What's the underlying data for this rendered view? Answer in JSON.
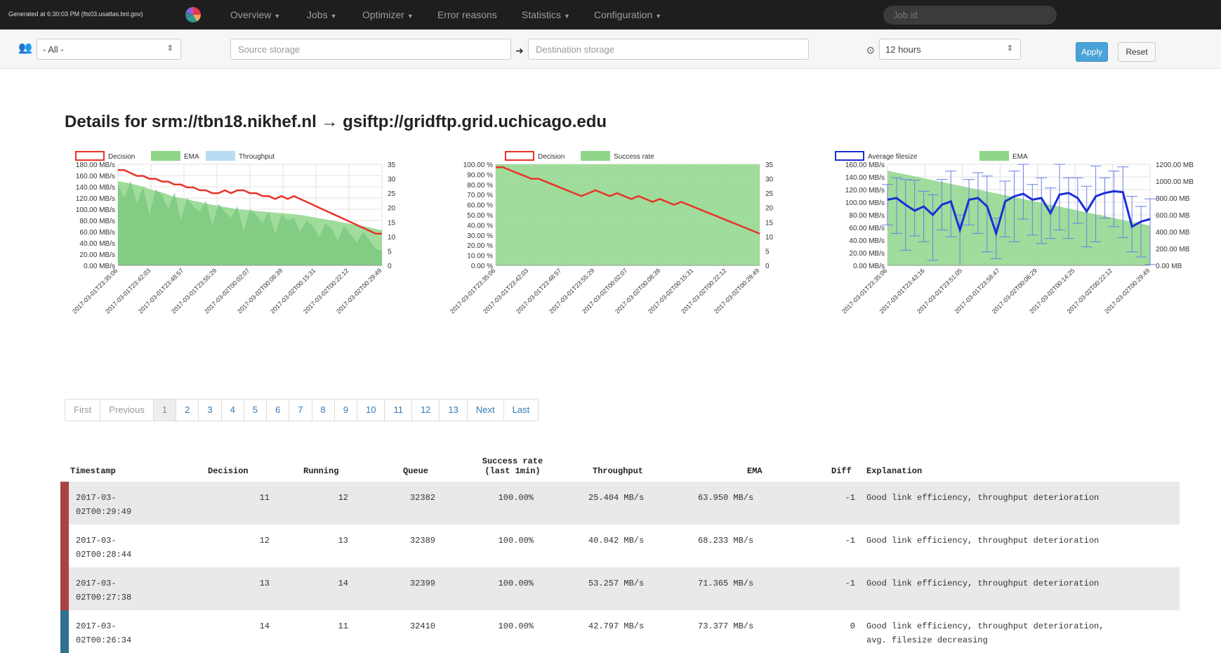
{
  "navbar": {
    "generated": "Generated at 6:30:03 PM (fts03.usatlas.bnl.gov)",
    "items": [
      {
        "label": "Overview",
        "caret": true
      },
      {
        "label": "Jobs",
        "caret": true
      },
      {
        "label": "Optimizer",
        "caret": true
      },
      {
        "label": "Error reasons",
        "caret": false
      },
      {
        "label": "Statistics",
        "caret": true
      },
      {
        "label": "Configuration",
        "caret": true
      }
    ],
    "jobid_placeholder": "Job id"
  },
  "filters": {
    "vo_value": "- All -",
    "source_placeholder": "Source storage",
    "destination_placeholder": "Destination storage",
    "time_window": "12 hours",
    "apply_label": "Apply",
    "reset_label": "Reset"
  },
  "page_title": "Details for srm://tbn18.nikhef.nl → gsiftp://gridftp.grid.uchicago.edu",
  "chart_data": [
    {
      "type": "area",
      "legend": [
        "Decision",
        "EMA",
        "Throughput"
      ],
      "y_left_ticks": [
        "180.00 MB/s",
        "160.00 MB/s",
        "140.00 MB/s",
        "120.00 MB/s",
        "100.00 MB/s",
        "80.00 MB/s",
        "60.00 MB/s",
        "40.00 MB/s",
        "20.00 MB/s",
        "0.00 MB/s"
      ],
      "y_right_ticks": [
        "35",
        "30",
        "25",
        "20",
        "15",
        "10",
        "5",
        "0"
      ],
      "x_ticks": [
        "2017-03-01T23:35:06",
        "2017-03-01T23:42:03",
        "2017-03-01T23:48:57",
        "2017-03-01T23:55:29",
        "2017-03-02T00:02:07",
        "2017-03-02T00:08:39",
        "2017-03-02T00:15:31",
        "2017-03-02T00:22:12",
        "2017-03-02T00:29:49"
      ],
      "decision": [
        33,
        33,
        32,
        31,
        31,
        30,
        30,
        29,
        29,
        28,
        28,
        27,
        27,
        26,
        26,
        25,
        25,
        26,
        25,
        26,
        26,
        25,
        25,
        24,
        24,
        23,
        24,
        23,
        24,
        23,
        22,
        21,
        20,
        19,
        18,
        17,
        16,
        15,
        14,
        13,
        12,
        11,
        11
      ],
      "ema": [
        150,
        148,
        146,
        143,
        140,
        136,
        133,
        130,
        126,
        122,
        120,
        118,
        115,
        113,
        110,
        108,
        106,
        104,
        102,
        100,
        99,
        98,
        97,
        96,
        95,
        94,
        93,
        92,
        91,
        90,
        88,
        86,
        84,
        82,
        80,
        78,
        76,
        74,
        72,
        70,
        68,
        65,
        63
      ],
      "throughput": [
        145,
        120,
        150,
        110,
        140,
        90,
        135,
        125,
        100,
        130,
        80,
        120,
        105,
        95,
        115,
        70,
        110,
        95,
        85,
        105,
        60,
        100,
        90,
        75,
        95,
        55,
        90,
        80,
        85,
        60,
        80,
        70,
        50,
        75,
        65,
        45,
        70,
        55,
        40,
        60,
        45,
        30,
        25
      ]
    },
    {
      "type": "area",
      "legend": [
        "Decision",
        "Success rate"
      ],
      "y_left_ticks": [
        "100.00 %",
        "90.00 %",
        "80.00 %",
        "70.00 %",
        "60.00 %",
        "50.00 %",
        "40.00 %",
        "30.00 %",
        "20.00 %",
        "10.00 %",
        "0.00 %"
      ],
      "y_right_ticks": [
        "35",
        "30",
        "25",
        "20",
        "15",
        "10",
        "5",
        "0"
      ],
      "x_ticks": [
        "2017-03-01T23:35:06",
        "2017-03-01T23:42:03",
        "2017-03-01T23:48:57",
        "2017-03-01T23:55:29",
        "2017-03-02T00:02:07",
        "2017-03-02T00:08:39",
        "2017-03-02T00:15:31",
        "2017-03-02T00:22:12",
        "2017-03-02T00:29:49"
      ],
      "success_rate": 100,
      "decision": [
        34,
        34,
        33,
        32,
        31,
        30,
        30,
        29,
        28,
        27,
        26,
        25,
        24,
        25,
        26,
        25,
        24,
        25,
        24,
        23,
        24,
        23,
        22,
        23,
        22,
        21,
        22,
        21,
        20,
        19,
        18,
        17,
        16,
        15,
        14,
        13,
        12,
        11
      ]
    },
    {
      "type": "area",
      "legend": [
        "Average filesize",
        "EMA"
      ],
      "y_left_ticks": [
        "160.00 MB/s",
        "140.00 MB/s",
        "120.00 MB/s",
        "100.00 MB/s",
        "80.00 MB/s",
        "60.00 MB/s",
        "40.00 MB/s",
        "20.00 MB/s",
        "0.00 MB/s"
      ],
      "y_right_ticks": [
        "1200.00 MB",
        "1000.00 MB",
        "800.00 MB",
        "600.00 MB",
        "400.00 MB",
        "200.00 MB",
        "0.00 MB"
      ],
      "x_ticks": [
        "2017-03-01T23:35:06",
        "2017-03-01T23:43:16",
        "2017-03-01T23:51:05",
        "2017-03-01T23:58:47",
        "2017-03-02T00:06:29",
        "2017-03-02T00:14:25",
        "2017-03-02T00:22:12",
        "2017-03-02T00:29:49"
      ],
      "ema": [
        150,
        147,
        144,
        141,
        138,
        135,
        132,
        129,
        126,
        123,
        120,
        117,
        114,
        111,
        108,
        105,
        102,
        99,
        96,
        93,
        90,
        87,
        84,
        81,
        78,
        75,
        72,
        69,
        66,
        63
      ],
      "avg_filesize": [
        780,
        800,
        720,
        650,
        700,
        600,
        720,
        760,
        420,
        780,
        800,
        700,
        380,
        760,
        820,
        850,
        780,
        800,
        620,
        840,
        860,
        800,
        640,
        820,
        860,
        880,
        870,
        460,
        520,
        550
      ]
    }
  ],
  "pagination": [
    "First",
    "Previous",
    "1",
    "2",
    "3",
    "4",
    "5",
    "6",
    "7",
    "8",
    "9",
    "10",
    "11",
    "12",
    "13",
    "Next",
    "Last"
  ],
  "table": {
    "headers": {
      "timestamp": "Timestamp",
      "decision": "Decision",
      "running": "Running",
      "queue": "Queue",
      "success_rate_1": "Success rate",
      "success_rate_2": "(last 1min)",
      "throughput": "Throughput",
      "ema": "EMA",
      "diff": "Diff",
      "explanation": "Explanation"
    },
    "rows": [
      {
        "ts1": "2017-03-",
        "ts2": "02T00:29:49",
        "decision": "11",
        "running": "12",
        "queue": "32382",
        "success": "100.00%",
        "throughput": "25.404 MB/s",
        "ema": "63.950 MB/s",
        "diff": "-1",
        "exp1": "Good link efficiency, throughput deterioration",
        "exp2": "",
        "color": "#a94442"
      },
      {
        "ts1": "2017-03-",
        "ts2": "02T00:28:44",
        "decision": "12",
        "running": "13",
        "queue": "32389",
        "success": "100.00%",
        "throughput": "40.042 MB/s",
        "ema": "68.233 MB/s",
        "diff": "-1",
        "exp1": "Good link efficiency, throughput deterioration",
        "exp2": "",
        "color": "#a94442"
      },
      {
        "ts1": "2017-03-",
        "ts2": "02T00:27:38",
        "decision": "13",
        "running": "14",
        "queue": "32399",
        "success": "100.00%",
        "throughput": "53.257 MB/s",
        "ema": "71.365 MB/s",
        "diff": "-1",
        "exp1": "Good link efficiency, throughput deterioration",
        "exp2": "",
        "color": "#a94442"
      },
      {
        "ts1": "2017-03-",
        "ts2": "02T00:26:34",
        "decision": "14",
        "running": "11",
        "queue": "32410",
        "success": "100.00%",
        "throughput": "42.797 MB/s",
        "ema": "73.377 MB/s",
        "diff": "0",
        "exp1": "Good link efficiency, throughput deterioration,",
        "exp2": "avg. filesize decreasing",
        "color": "#31708f"
      }
    ]
  },
  "colors": {
    "decision": "#e8332a",
    "ema_fill": "#8fd68a",
    "ema_line": "#5cb85c",
    "throughput": "#b9dcf3",
    "filesize": "#1a2fd6"
  }
}
